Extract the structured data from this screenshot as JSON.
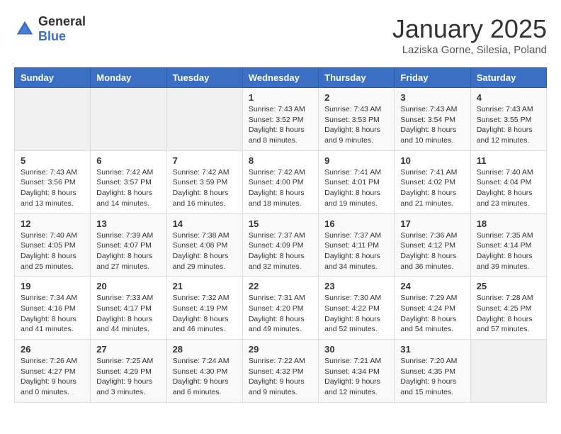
{
  "header": {
    "logo_general": "General",
    "logo_blue": "Blue",
    "month_year": "January 2025",
    "location": "Laziska Gorne, Silesia, Poland"
  },
  "days_of_week": [
    "Sunday",
    "Monday",
    "Tuesday",
    "Wednesday",
    "Thursday",
    "Friday",
    "Saturday"
  ],
  "weeks": [
    [
      {
        "day": "",
        "info": ""
      },
      {
        "day": "",
        "info": ""
      },
      {
        "day": "",
        "info": ""
      },
      {
        "day": "1",
        "info": "Sunrise: 7:43 AM\nSunset: 3:52 PM\nDaylight: 8 hours and 8 minutes."
      },
      {
        "day": "2",
        "info": "Sunrise: 7:43 AM\nSunset: 3:53 PM\nDaylight: 8 hours and 9 minutes."
      },
      {
        "day": "3",
        "info": "Sunrise: 7:43 AM\nSunset: 3:54 PM\nDaylight: 8 hours and 10 minutes."
      },
      {
        "day": "4",
        "info": "Sunrise: 7:43 AM\nSunset: 3:55 PM\nDaylight: 8 hours and 12 minutes."
      }
    ],
    [
      {
        "day": "5",
        "info": "Sunrise: 7:43 AM\nSunset: 3:56 PM\nDaylight: 8 hours and 13 minutes."
      },
      {
        "day": "6",
        "info": "Sunrise: 7:42 AM\nSunset: 3:57 PM\nDaylight: 8 hours and 14 minutes."
      },
      {
        "day": "7",
        "info": "Sunrise: 7:42 AM\nSunset: 3:59 PM\nDaylight: 8 hours and 16 minutes."
      },
      {
        "day": "8",
        "info": "Sunrise: 7:42 AM\nSunset: 4:00 PM\nDaylight: 8 hours and 18 minutes."
      },
      {
        "day": "9",
        "info": "Sunrise: 7:41 AM\nSunset: 4:01 PM\nDaylight: 8 hours and 19 minutes."
      },
      {
        "day": "10",
        "info": "Sunrise: 7:41 AM\nSunset: 4:02 PM\nDaylight: 8 hours and 21 minutes."
      },
      {
        "day": "11",
        "info": "Sunrise: 7:40 AM\nSunset: 4:04 PM\nDaylight: 8 hours and 23 minutes."
      }
    ],
    [
      {
        "day": "12",
        "info": "Sunrise: 7:40 AM\nSunset: 4:05 PM\nDaylight: 8 hours and 25 minutes."
      },
      {
        "day": "13",
        "info": "Sunrise: 7:39 AM\nSunset: 4:07 PM\nDaylight: 8 hours and 27 minutes."
      },
      {
        "day": "14",
        "info": "Sunrise: 7:38 AM\nSunset: 4:08 PM\nDaylight: 8 hours and 29 minutes."
      },
      {
        "day": "15",
        "info": "Sunrise: 7:37 AM\nSunset: 4:09 PM\nDaylight: 8 hours and 32 minutes."
      },
      {
        "day": "16",
        "info": "Sunrise: 7:37 AM\nSunset: 4:11 PM\nDaylight: 8 hours and 34 minutes."
      },
      {
        "day": "17",
        "info": "Sunrise: 7:36 AM\nSunset: 4:12 PM\nDaylight: 8 hours and 36 minutes."
      },
      {
        "day": "18",
        "info": "Sunrise: 7:35 AM\nSunset: 4:14 PM\nDaylight: 8 hours and 39 minutes."
      }
    ],
    [
      {
        "day": "19",
        "info": "Sunrise: 7:34 AM\nSunset: 4:16 PM\nDaylight: 8 hours and 41 minutes."
      },
      {
        "day": "20",
        "info": "Sunrise: 7:33 AM\nSunset: 4:17 PM\nDaylight: 8 hours and 44 minutes."
      },
      {
        "day": "21",
        "info": "Sunrise: 7:32 AM\nSunset: 4:19 PM\nDaylight: 8 hours and 46 minutes."
      },
      {
        "day": "22",
        "info": "Sunrise: 7:31 AM\nSunset: 4:20 PM\nDaylight: 8 hours and 49 minutes."
      },
      {
        "day": "23",
        "info": "Sunrise: 7:30 AM\nSunset: 4:22 PM\nDaylight: 8 hours and 52 minutes."
      },
      {
        "day": "24",
        "info": "Sunrise: 7:29 AM\nSunset: 4:24 PM\nDaylight: 8 hours and 54 minutes."
      },
      {
        "day": "25",
        "info": "Sunrise: 7:28 AM\nSunset: 4:25 PM\nDaylight: 8 hours and 57 minutes."
      }
    ],
    [
      {
        "day": "26",
        "info": "Sunrise: 7:26 AM\nSunset: 4:27 PM\nDaylight: 9 hours and 0 minutes."
      },
      {
        "day": "27",
        "info": "Sunrise: 7:25 AM\nSunset: 4:29 PM\nDaylight: 9 hours and 3 minutes."
      },
      {
        "day": "28",
        "info": "Sunrise: 7:24 AM\nSunset: 4:30 PM\nDaylight: 9 hours and 6 minutes."
      },
      {
        "day": "29",
        "info": "Sunrise: 7:22 AM\nSunset: 4:32 PM\nDaylight: 9 hours and 9 minutes."
      },
      {
        "day": "30",
        "info": "Sunrise: 7:21 AM\nSunset: 4:34 PM\nDaylight: 9 hours and 12 minutes."
      },
      {
        "day": "31",
        "info": "Sunrise: 7:20 AM\nSunset: 4:35 PM\nDaylight: 9 hours and 15 minutes."
      },
      {
        "day": "",
        "info": ""
      }
    ]
  ]
}
